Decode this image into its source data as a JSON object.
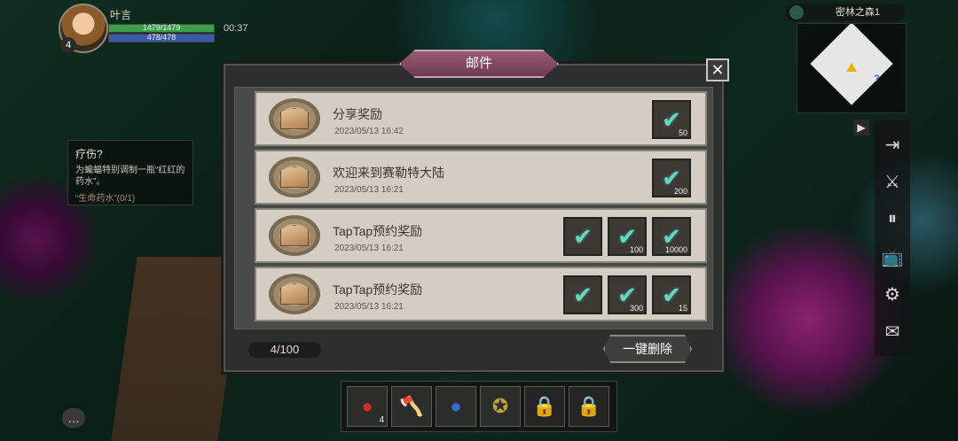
{
  "player": {
    "name": "叶言",
    "level": "4",
    "hp": "1479/1479",
    "mp": "478/478",
    "timer": "00:37"
  },
  "quest": {
    "title": "疗伤?",
    "desc": "为蝙蝠特别调制一瓶“红红的药水”。",
    "progress": "“生命药水”(0/1)"
  },
  "map": {
    "name": "密林之森1"
  },
  "mail_dialog": {
    "title": "邮件",
    "close": "✕",
    "count": "4/100",
    "delete_all": "一键删除",
    "mails": [
      {
        "title": "分享奖励",
        "date": "2023/05/13 16:42",
        "rewards": [
          {
            "count": "50"
          }
        ]
      },
      {
        "title": "欢迎来到赛勒特大陆",
        "date": "2023/05/13 16:21",
        "rewards": [
          {
            "count": "200"
          }
        ]
      },
      {
        "title": "TapTap预约奖励",
        "date": "2023/05/13 16:21",
        "rewards": [
          {
            "count": ""
          },
          {
            "count": "100"
          },
          {
            "count": "10000"
          }
        ]
      },
      {
        "title": "TapTap预约奖励",
        "date": "2023/05/13 16:21",
        "rewards": [
          {
            "count": ""
          },
          {
            "count": "300"
          },
          {
            "count": "15"
          }
        ]
      }
    ]
  },
  "hotbar": {
    "slot1_count": "4"
  },
  "colors": {
    "dialog_bg": "#2d2f2e",
    "title_banner": "#9a5a74",
    "mail_card": "#d3cdc4",
    "check": "#5ae0a8"
  }
}
